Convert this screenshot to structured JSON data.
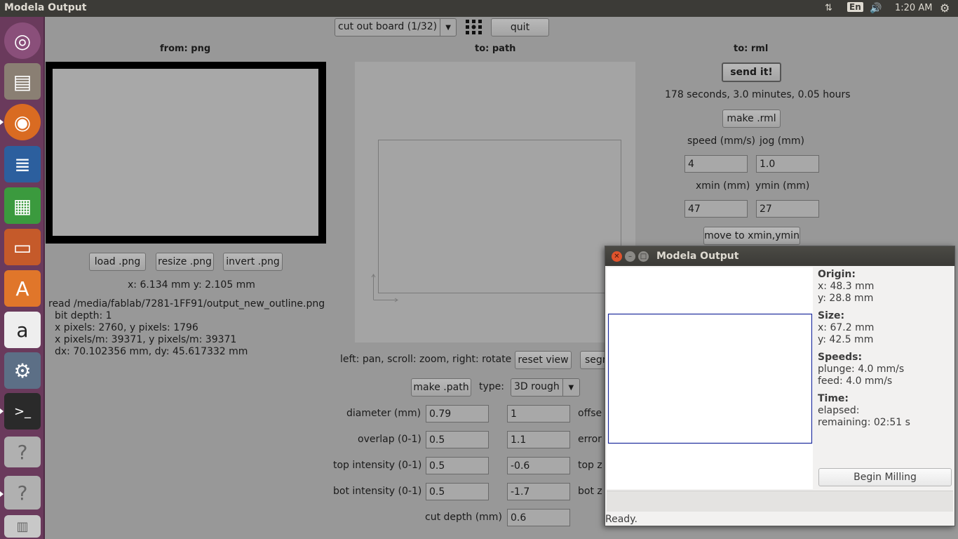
{
  "topbar": {
    "window_title": "Modela Output",
    "lang": "En",
    "time": "1:20 AM"
  },
  "launcher": {
    "icons": [
      "ubuntu-dash-icon",
      "files-icon",
      "firefox-icon",
      "writer-icon",
      "calc-icon",
      "impress-icon",
      "software-center-icon",
      "amazon-icon",
      "system-settings-icon",
      "terminal-icon",
      "unknown-app-icon",
      "unknown-app-icon",
      "trash-icon"
    ]
  },
  "toolbar": {
    "process_selected": "cut out board (1/32)",
    "quit_label": "quit"
  },
  "from_png": {
    "header": "from: png",
    "load_label": "load .png",
    "resize_label": "resize .png",
    "invert_label": "invert .png",
    "coords": "x: 6.134 mm  y: 2.105 mm",
    "info_lines": [
      "read /media/fablab/7281-1FF91/output_new_outline.png",
      "bit depth: 1",
      "x pixels: 2760, y pixels: 1796",
      "x pixels/m: 39371, y pixels/m: 39371",
      "dx: 70.102356 mm, dy: 45.617332 mm"
    ]
  },
  "to_path": {
    "header": "to: path",
    "help_text": "left: pan, scroll: zoom, right: rotate",
    "reset_view_label": "reset view",
    "segment_label": "segm",
    "make_path_label": "make .path",
    "type_label": "type:",
    "type_value": "3D rough",
    "diameter_label": "diameter (mm)",
    "diameter_value": "0.79",
    "offsets_label": "offse",
    "offsets_value": "1",
    "overlap_label": "overlap (0-1)",
    "overlap_value": "0.5",
    "error_label": "error",
    "error_value": "1.1",
    "top_intensity_label": "top intensity (0-1)",
    "top_intensity_value": "0.5",
    "top_z_label": "top z",
    "top_z_value": "-0.6",
    "bot_intensity_label": "bot intensity (0-1)",
    "bot_intensity_value": "0.5",
    "bot_z_label": "bot z",
    "bot_z_value": "-1.7",
    "cut_depth_label": "cut depth (mm)",
    "cut_depth_value": "0.6"
  },
  "to_rml": {
    "header": "to: rml",
    "send_label": "send it!",
    "time_estimate": "178 seconds, 3.0 minutes, 0.05 hours",
    "make_rml_label": "make .rml",
    "speed_label": "speed (mm/s)",
    "speed_value": "4",
    "jog_label": "jog (mm)",
    "jog_value": "1.0",
    "xmin_label": "xmin (mm)",
    "xmin_value": "47",
    "ymin_label": "ymin (mm)",
    "ymin_value": "27",
    "move_label": "move to xmin,ymin"
  },
  "modela": {
    "title": "Modela Output",
    "origin_head": "Origin:",
    "origin_x": "x: 48.3 mm",
    "origin_y": "y: 28.8 mm",
    "size_head": "Size:",
    "size_x": "x: 67.2 mm",
    "size_y": "y: 42.5 mm",
    "speeds_head": "Speeds:",
    "plunge": "plunge: 4.0 mm/s",
    "feed": "feed: 4.0 mm/s",
    "time_head": "Time:",
    "elapsed": "elapsed:",
    "remaining": "remaining: 02:51 s",
    "begin_label": "Begin Milling",
    "status": "Ready."
  },
  "colors": {
    "launcher_bg": "#6a3a5c",
    "panel_bg": "#3c3b37",
    "toolpath_line": "#1c2a9c"
  }
}
